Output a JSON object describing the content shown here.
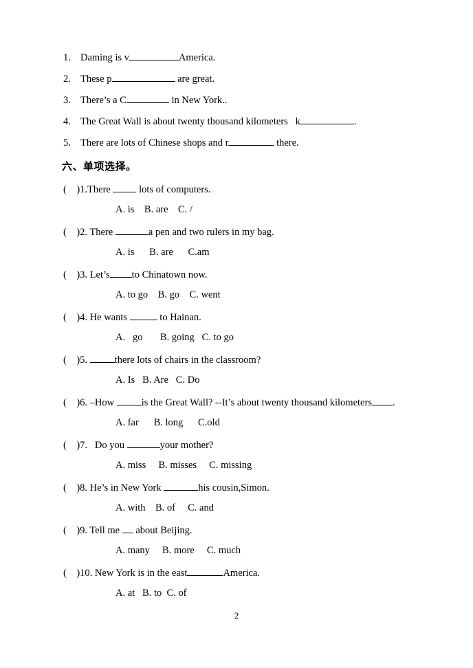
{
  "document": {
    "page_number": "2"
  },
  "fill_in_section": {
    "items": [
      {
        "number": "1.",
        "pre": "Daming is v",
        "blank_width": 72,
        "post": "America."
      },
      {
        "number": "2.",
        "pre": "These p",
        "blank_width": 92,
        "post": " are great."
      },
      {
        "number": "3.",
        "pre": "There’s a C",
        "blank_width": 62,
        "post": " in New York.."
      },
      {
        "number": "4.",
        "pre": "The Great Wall is about twenty thousand kilometers   k",
        "blank_width": 78,
        "post": "."
      },
      {
        "number": "5.",
        "pre": "There are lots of Chinese shops and r",
        "blank_width": 66,
        "post": " there."
      }
    ]
  },
  "mc_section": {
    "heading": "六、单项选择。",
    "items": [
      {
        "paren": "(    )",
        "number": "1.",
        "pre": "There ",
        "blank_width": 34,
        "post": " lots of computers.",
        "choices": "A. is    B. are    C. /"
      },
      {
        "paren": "(    )",
        "number": "2. ",
        "pre": "There ",
        "blank_width": 48,
        "post": "a pen and two rulers in my bag.",
        "choices": "A. is      B. are      C.am"
      },
      {
        "paren": "(    )",
        "number": "3. ",
        "pre": "Let’s",
        "blank_width": 32,
        "post": "to Chinatown now.",
        "choices": "A. to go    B. go    C. went"
      },
      {
        "paren": "(    )",
        "number": "4. ",
        "pre": "He wants ",
        "blank_width": 40,
        "post": " to Hainan.",
        "choices": "A.   go       B. going   C. to go"
      },
      {
        "paren": "(    )",
        "number": "5. ",
        "pre": "",
        "blank_width": 36,
        "post": "there lots of chairs in the classroom?",
        "choices": "A. Is   B. Are   C. Do"
      },
      {
        "paren": "(    )",
        "number": "6. ",
        "pre": "–How ",
        "blank_width": 36,
        "post": "is the Great Wall? --It’s about twenty thousand kilometers",
        "blank2_width": 30,
        "post2": ".",
        "choices": "A. far      B. long      C.old"
      },
      {
        "paren": "(    )",
        "number": "7.  ",
        "pre": " Do you ",
        "blank_width": 48,
        "post": "your mother?",
        "choices": "A. miss     B. misses     C. missing"
      },
      {
        "paren": "(    )",
        "number": "8. ",
        "pre": "He’s in New York ",
        "blank_width": 50,
        "post": "his cousin,Simon.",
        "choices": "A. with    B. of     C. and"
      },
      {
        "paren": "(    )",
        "number": "9. ",
        "pre": "Tell me ",
        "blank_width": 16,
        "post": " about Beijing.",
        "choices": "A. many     B. more     C. much"
      },
      {
        "paren": "(    )",
        "number": "10. ",
        "pre": "New York is in the east",
        "blank_width": 52,
        "post": "America.",
        "choices": "A. at   B. to  C. of"
      }
    ]
  }
}
